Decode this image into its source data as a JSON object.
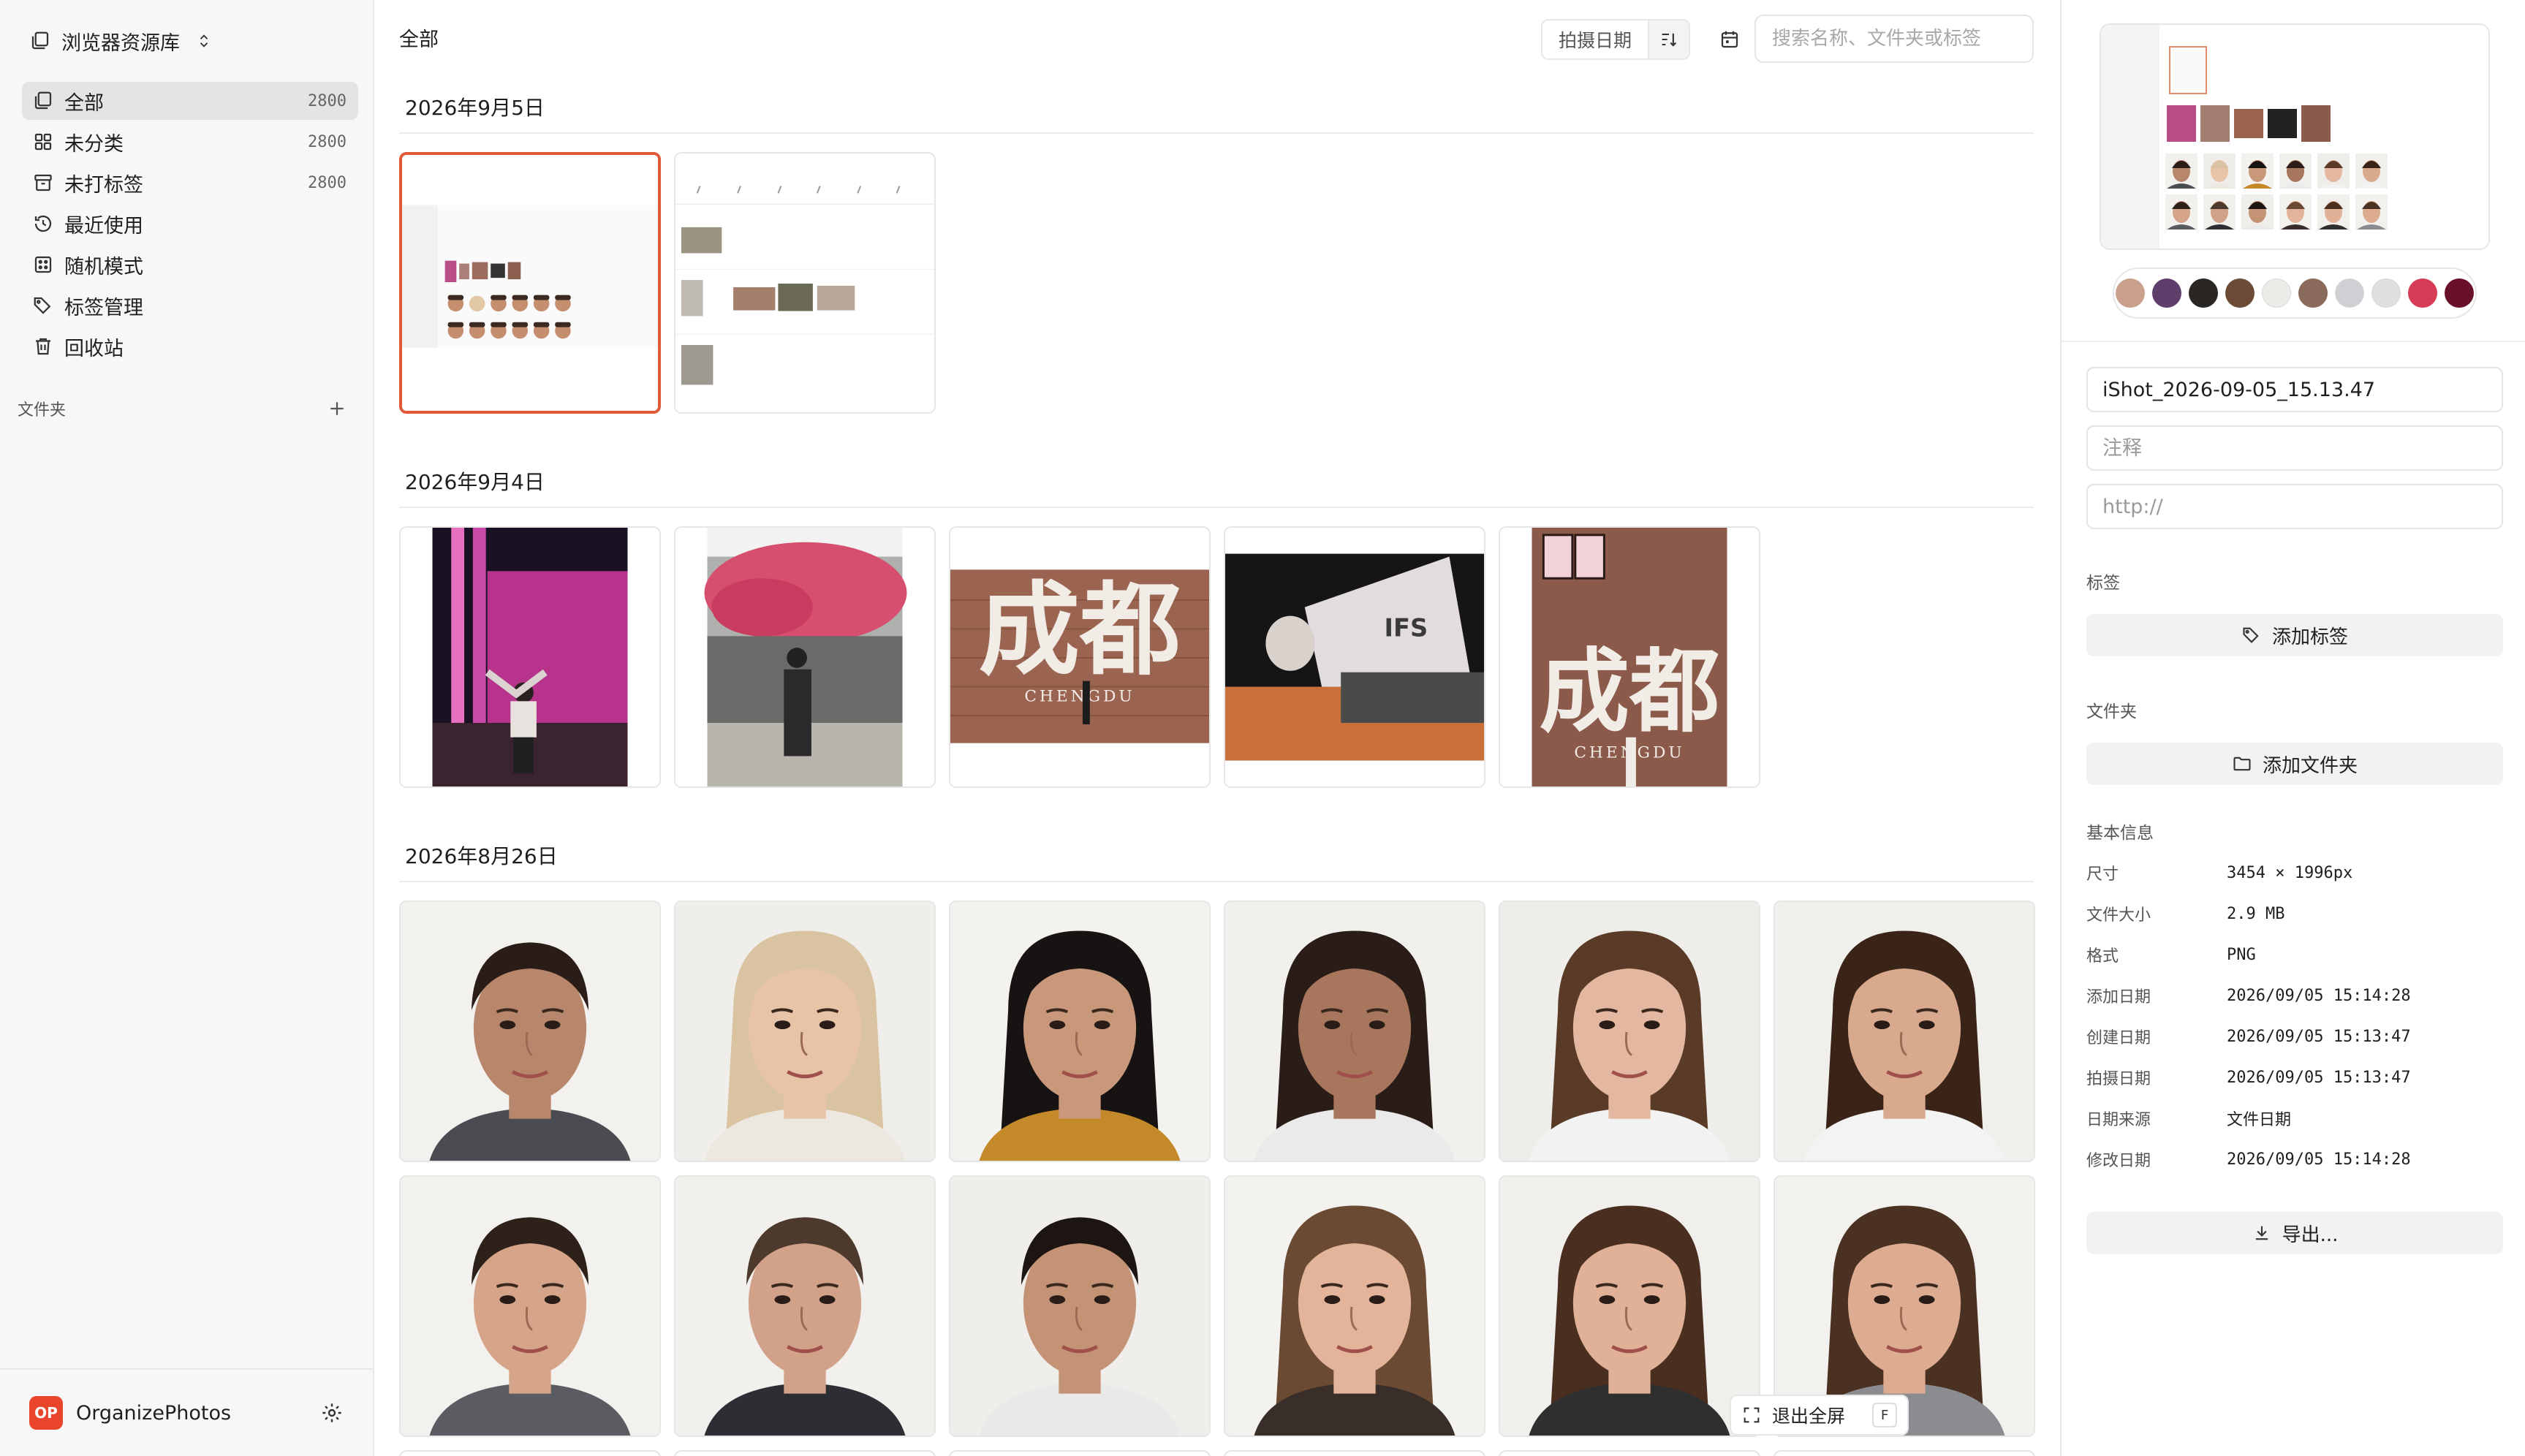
{
  "sidebar": {
    "library_label": "浏览器资源库",
    "nav": [
      {
        "label": "全部",
        "count": "2800",
        "icon": "library-icon"
      },
      {
        "label": "未分类",
        "count": "2800",
        "icon": "grid-icon"
      },
      {
        "label": "未打标签",
        "count": "2800",
        "icon": "archive-icon"
      },
      {
        "label": "最近使用",
        "count": "",
        "icon": "history-icon"
      },
      {
        "label": "随机模式",
        "count": "",
        "icon": "dice-icon"
      },
      {
        "label": "标签管理",
        "count": "",
        "icon": "tags-icon"
      },
      {
        "label": "回收站",
        "count": "",
        "icon": "trash-icon"
      }
    ],
    "folders_label": "文件夹",
    "footer": {
      "badge": "OP",
      "app_name": "OrganizePhotos"
    }
  },
  "main": {
    "title": "全部",
    "sort_label": "拍摄日期",
    "search_placeholder": "搜索名称、文件夹或标签",
    "sections": [
      {
        "date": "2026年9月5日",
        "count": 2
      },
      {
        "date": "2026年9月4日",
        "count": 5
      },
      {
        "date": "2026年8月26日",
        "count": 12
      }
    ],
    "photo_text": {
      "chengdu_zh": "成都",
      "chengdu_en": "CHENGDU",
      "ifs": "IFS"
    }
  },
  "detail": {
    "filename": "iShot_2026-09-05_15.13.47",
    "note_placeholder": "注释",
    "url_placeholder": "http://",
    "palette": [
      "#c9a08c",
      "#5e3f6b",
      "#2a2623",
      "#6b4a36",
      "#ecebe8",
      "#8a6a5a",
      "#cfd0d4",
      "#dedfde",
      "#d83b55",
      "#6a1028"
    ],
    "tags_label": "标签",
    "add_tag_label": "添加标签",
    "folder_label": "文件夹",
    "add_folder_label": "添加文件夹",
    "basic_info_label": "基本信息",
    "info": [
      {
        "key": "尺寸",
        "value": "3454 × 1996px"
      },
      {
        "key": "文件大小",
        "value": "2.9 MB"
      },
      {
        "key": "格式",
        "value": "PNG"
      },
      {
        "key": "添加日期",
        "value": "2026/09/05 15:14:28"
      },
      {
        "key": "创建日期",
        "value": "2026/09/05 15:13:47"
      },
      {
        "key": "拍摄日期",
        "value": "2026/09/05 15:13:47"
      },
      {
        "key": "日期来源",
        "value": "文件日期"
      },
      {
        "key": "修改日期",
        "value": "2026/09/05 15:14:28"
      }
    ],
    "export_label": "导出...",
    "exit_fullscreen_label": "退出全屏",
    "exit_fullscreen_key": "F"
  }
}
